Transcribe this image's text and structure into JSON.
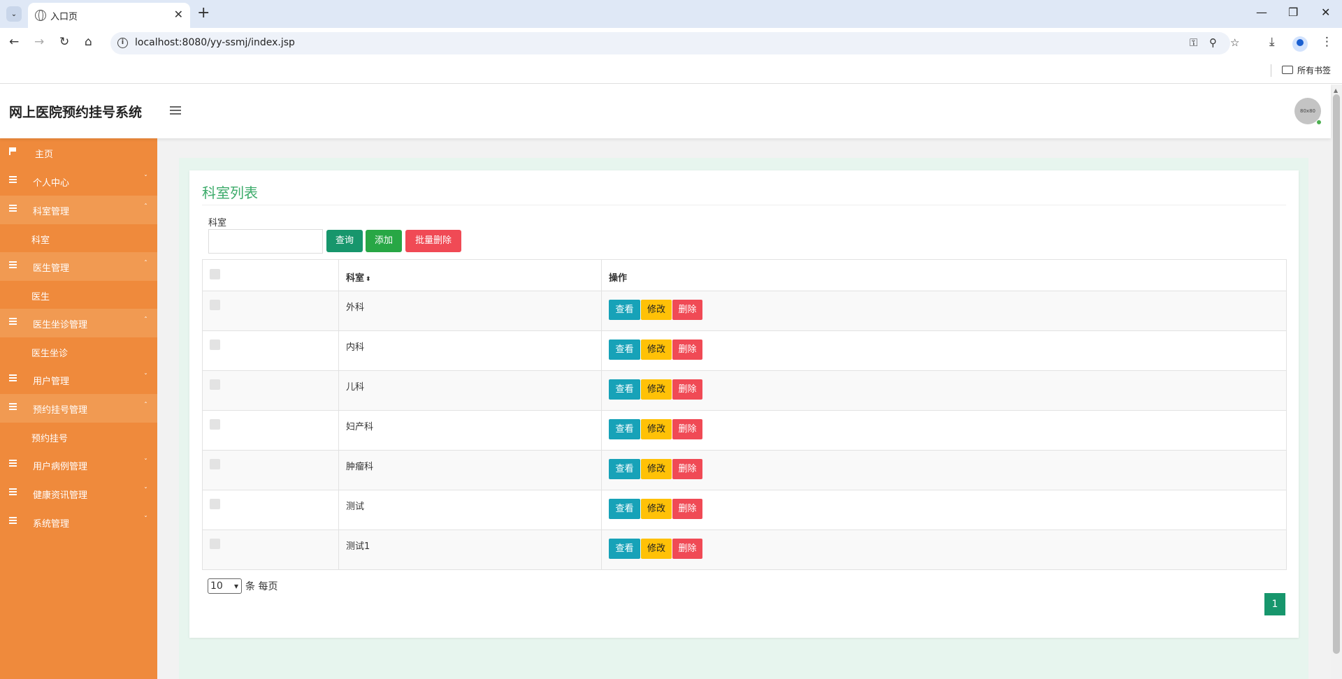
{
  "browser": {
    "tab_title": "入口页",
    "url": "localhost:8080/yy-ssmj/index.jsp",
    "bookmarks_label": "所有书签"
  },
  "header": {
    "app_title": "网上医院预约挂号系统",
    "avatar_text": "80x80"
  },
  "sidebar": {
    "items": [
      {
        "label": "主页",
        "icon": "flag-icon",
        "type": "home"
      },
      {
        "label": "个人中心",
        "icon": "list-icon",
        "type": "group"
      },
      {
        "label": "科室管理",
        "icon": "list-icon",
        "type": "group",
        "open": true
      },
      {
        "label": "科室",
        "type": "sub"
      },
      {
        "label": "医生管理",
        "icon": "list-icon",
        "type": "group",
        "open": true
      },
      {
        "label": "医生",
        "type": "sub"
      },
      {
        "label": "医生坐诊管理",
        "icon": "list-icon",
        "type": "group",
        "open": true
      },
      {
        "label": "医生坐诊",
        "type": "sub"
      },
      {
        "label": "用户管理",
        "icon": "list-icon",
        "type": "group"
      },
      {
        "label": "预约挂号管理",
        "icon": "list-icon",
        "type": "group",
        "open": true
      },
      {
        "label": "预约挂号",
        "type": "sub"
      },
      {
        "label": "用户病例管理",
        "icon": "list-icon",
        "type": "group"
      },
      {
        "label": "健康资讯管理",
        "icon": "list-icon",
        "type": "group"
      },
      {
        "label": "系统管理",
        "icon": "list-icon",
        "type": "group"
      }
    ],
    "color": "#ef8a3c"
  },
  "main": {
    "card_title": "科室列表",
    "filter": {
      "label": "科室",
      "value": "",
      "query_label": "查询",
      "add_label": "添加",
      "bulk_delete_label": "批量删除"
    },
    "table": {
      "headers": [
        "",
        "科室",
        "操作"
      ],
      "rows": [
        {
          "name": "外科"
        },
        {
          "name": "内科"
        },
        {
          "name": "儿科"
        },
        {
          "name": "妇产科"
        },
        {
          "name": "肿瘤科"
        },
        {
          "name": "测试"
        },
        {
          "name": "测试1"
        }
      ],
      "actions": {
        "view": "查看",
        "edit": "修改",
        "delete": "删除"
      }
    },
    "pagination": {
      "page_size": "10",
      "page_size_suffix": "条 每页",
      "current_page": "1"
    },
    "accent_color": "#17966c"
  }
}
